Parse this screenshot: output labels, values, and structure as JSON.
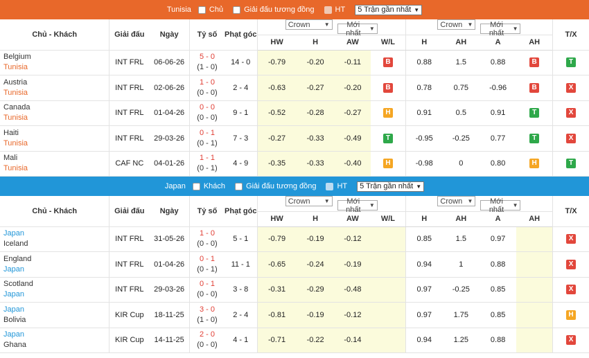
{
  "tunisia_bar": {
    "team": "Tunisia",
    "opt1": "Chủ",
    "opt2": "Giải đấu tương đồng",
    "opt3": "HT",
    "select": "5 Trận gần nhất"
  },
  "japan_bar": {
    "team": "Japan",
    "opt1": "Khách",
    "opt2": "Giải đấu tương đồng",
    "opt3": "HT",
    "select": "5 Trận gần nhất"
  },
  "headers": {
    "teams": "Chủ - Khách",
    "league": "Giải đấu",
    "date": "Ngày",
    "score": "Tỷ số",
    "corners": "Phạt góc",
    "sel_book": "Crown",
    "sel_time": "Mới nhất",
    "hw": "HW",
    "h": "H",
    "aw": "AW",
    "wl": "W/L",
    "h2": "H",
    "ah": "AH",
    "a": "A",
    "ah2": "AH",
    "tx": "T/X"
  },
  "tunisia_rows": [
    {
      "home": "Belgium",
      "away": "Tunisia",
      "league": "INT FRL",
      "date": "06-06-26",
      "ft": "5 - 0",
      "ht": "(1 - 0)",
      "corners": "14 - 0",
      "hw": "-0.79",
      "h": "-0.20",
      "aw": "-0.11",
      "wl": "B",
      "h2": "0.88",
      "ah": "1.5",
      "a": "0.88",
      "ah2": "B",
      "tx": "T"
    },
    {
      "home": "Austria",
      "away": "Tunisia",
      "league": "INT FRL",
      "date": "02-06-26",
      "ft": "1 - 0",
      "ht": "(0 - 0)",
      "corners": "2 - 4",
      "hw": "-0.63",
      "h": "-0.27",
      "aw": "-0.20",
      "wl": "B",
      "h2": "0.78",
      "ah": "0.75",
      "a": "-0.96",
      "ah2": "B",
      "tx": "X"
    },
    {
      "home": "Canada",
      "away": "Tunisia",
      "league": "INT FRL",
      "date": "01-04-26",
      "ft": "0 - 0",
      "ht": "(0 - 0)",
      "corners": "9 - 1",
      "hw": "-0.52",
      "h": "-0.28",
      "aw": "-0.27",
      "wl": "H",
      "h2": "0.91",
      "ah": "0.5",
      "a": "0.91",
      "ah2": "T",
      "tx": "X"
    },
    {
      "home": "Haiti",
      "away": "Tunisia",
      "league": "INT FRL",
      "date": "29-03-26",
      "ft": "0 - 1",
      "ht": "(0 - 1)",
      "corners": "7 - 3",
      "hw": "-0.27",
      "h": "-0.33",
      "aw": "-0.49",
      "wl": "T",
      "h2": "-0.95",
      "ah": "-0.25",
      "a": "0.77",
      "ah2": "T",
      "tx": "X"
    },
    {
      "home": "Mali",
      "away": "Tunisia",
      "league": "CAF NC",
      "date": "04-01-26",
      "ft": "1 - 1",
      "ht": "(0 - 1)",
      "corners": "4 - 9",
      "hw": "-0.35",
      "h": "-0.33",
      "aw": "-0.40",
      "wl": "H",
      "h2": "-0.98",
      "ah": "0",
      "a": "0.80",
      "ah2": "H",
      "tx": "T"
    }
  ],
  "japan_rows": [
    {
      "home": "Japan",
      "away": "Iceland",
      "home_hl": true,
      "league": "INT FRL",
      "date": "31-05-26",
      "ft": "1 - 0",
      "ht": "(0 - 0)",
      "corners": "5 - 1",
      "hw": "-0.79",
      "h": "-0.19",
      "aw": "-0.12",
      "wl": "",
      "h2": "0.85",
      "ah": "1.5",
      "a": "0.97",
      "ah2": "",
      "tx": "X"
    },
    {
      "home": "England",
      "away": "Japan",
      "home_hl": false,
      "league": "INT FRL",
      "date": "01-04-26",
      "ft": "0 - 1",
      "ht": "(0 - 1)",
      "corners": "11 - 1",
      "hw": "-0.65",
      "h": "-0.24",
      "aw": "-0.19",
      "wl": "",
      "h2": "0.94",
      "ah": "1",
      "a": "0.88",
      "ah2": "",
      "tx": "X"
    },
    {
      "home": "Scotland",
      "away": "Japan",
      "home_hl": false,
      "league": "INT FRL",
      "date": "29-03-26",
      "ft": "0 - 1",
      "ht": "(0 - 0)",
      "corners": "3 - 8",
      "hw": "-0.31",
      "h": "-0.29",
      "aw": "-0.48",
      "wl": "",
      "h2": "0.97",
      "ah": "-0.25",
      "a": "0.85",
      "ah2": "",
      "tx": "X"
    },
    {
      "home": "Japan",
      "away": "Bolivia",
      "home_hl": true,
      "league": "KIR Cup",
      "date": "18-11-25",
      "ft": "3 - 0",
      "ht": "(1 - 0)",
      "corners": "2 - 4",
      "hw": "-0.81",
      "h": "-0.19",
      "aw": "-0.12",
      "wl": "",
      "h2": "0.97",
      "ah": "1.75",
      "a": "0.85",
      "ah2": "",
      "tx": "H"
    },
    {
      "home": "Japan",
      "away": "Ghana",
      "home_hl": true,
      "league": "KIR Cup",
      "date": "14-11-25",
      "ft": "2 - 0",
      "ht": "(0 - 0)",
      "corners": "4 - 1",
      "hw": "-0.71",
      "h": "-0.22",
      "aw": "-0.14",
      "wl": "",
      "h2": "0.94",
      "ah": "1.25",
      "a": "0.88",
      "ah2": "",
      "tx": "X"
    }
  ],
  "colors": {
    "orange": "#e8682a",
    "blue": "#2196d8",
    "red": "#e2473c",
    "green": "#2ea84a",
    "amber": "#f5a623"
  }
}
